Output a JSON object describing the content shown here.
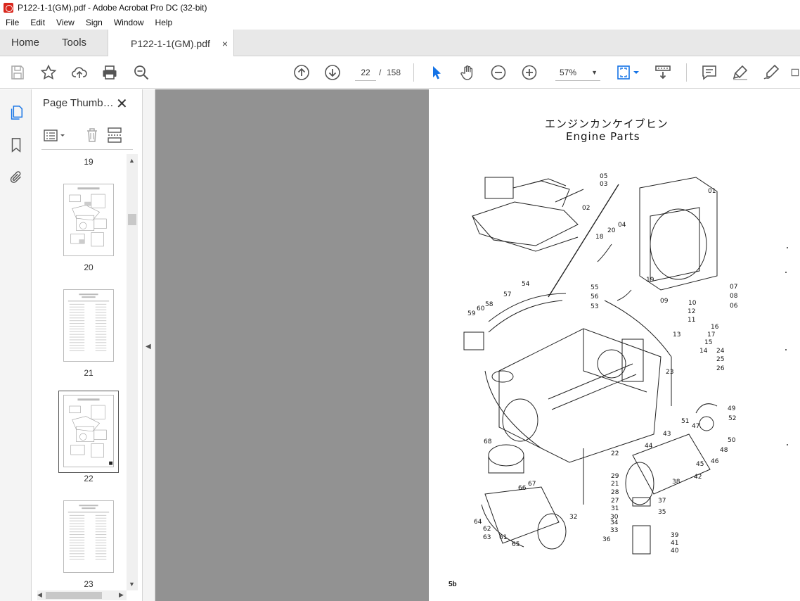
{
  "window": {
    "title": "P122-1-1(GM).pdf - Adobe Acrobat Pro DC (32-bit)"
  },
  "menu": [
    "File",
    "Edit",
    "View",
    "Sign",
    "Window",
    "Help"
  ],
  "tabs": {
    "home": "Home",
    "tools": "Tools",
    "document": "P122-1-1(GM).pdf",
    "close": "×"
  },
  "toolbar": {
    "current_page": "22",
    "separator": "/",
    "total_pages": "158",
    "zoom": "57%"
  },
  "thumbnail_panel": {
    "title": "Page Thumb…",
    "close": "✕",
    "pages": [
      "19",
      "20",
      "21",
      "22",
      "23"
    ],
    "selected_page": "22"
  },
  "document_page": {
    "title_jp": "エンジンカンケイブヒン",
    "title_en": "Engine Parts",
    "page_number": "5b",
    "part_numbers": [
      "01",
      "02",
      "03",
      "04",
      "05",
      "06",
      "07",
      "08",
      "09",
      "10",
      "11",
      "12",
      "13",
      "14",
      "15",
      "16",
      "17",
      "18",
      "19",
      "20",
      "21",
      "22",
      "23",
      "24",
      "25",
      "26",
      "27",
      "28",
      "29",
      "30",
      "31",
      "32",
      "33",
      "34",
      "35",
      "36",
      "37",
      "38",
      "39",
      "40",
      "41",
      "42",
      "43",
      "44",
      "45",
      "46",
      "47",
      "48",
      "49",
      "50",
      "51",
      "52",
      "53",
      "54",
      "55",
      "56",
      "57",
      "58",
      "59",
      "60",
      "61",
      "62",
      "63",
      "64",
      "65",
      "66",
      "67",
      "68"
    ]
  },
  "colors": {
    "accent": "#1473e6",
    "viewer_bg": "#929292",
    "tab_bg": "#e8e8e8"
  }
}
